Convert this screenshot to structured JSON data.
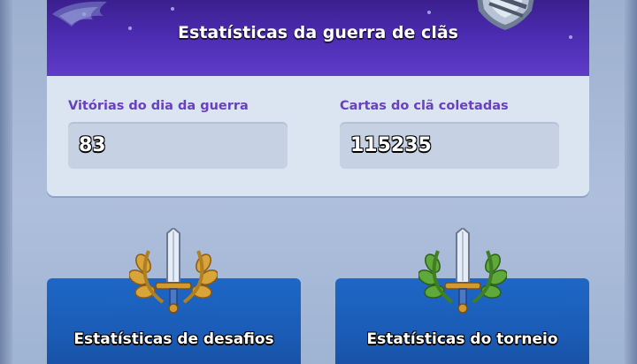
{
  "war_stats": {
    "title": "Estatísticas da guerra de clãs",
    "wins_label": "Vitórias do dia da guerra",
    "wins_value": "83",
    "cards_label": "Cartas do clã coletadas",
    "cards_value": "115235"
  },
  "challenge_card": {
    "label": "Estatísticas de desafios",
    "emblem": "gold-laurel-sword-icon"
  },
  "tournament_card": {
    "label": "Estatísticas do torneio",
    "emblem": "green-laurel-sword-icon"
  },
  "colors": {
    "header_purple": "#4b2bb0",
    "label_purple": "#6a3fc0",
    "card_blue": "#1a5bb5",
    "panel_bg": "#dbe5f2"
  }
}
